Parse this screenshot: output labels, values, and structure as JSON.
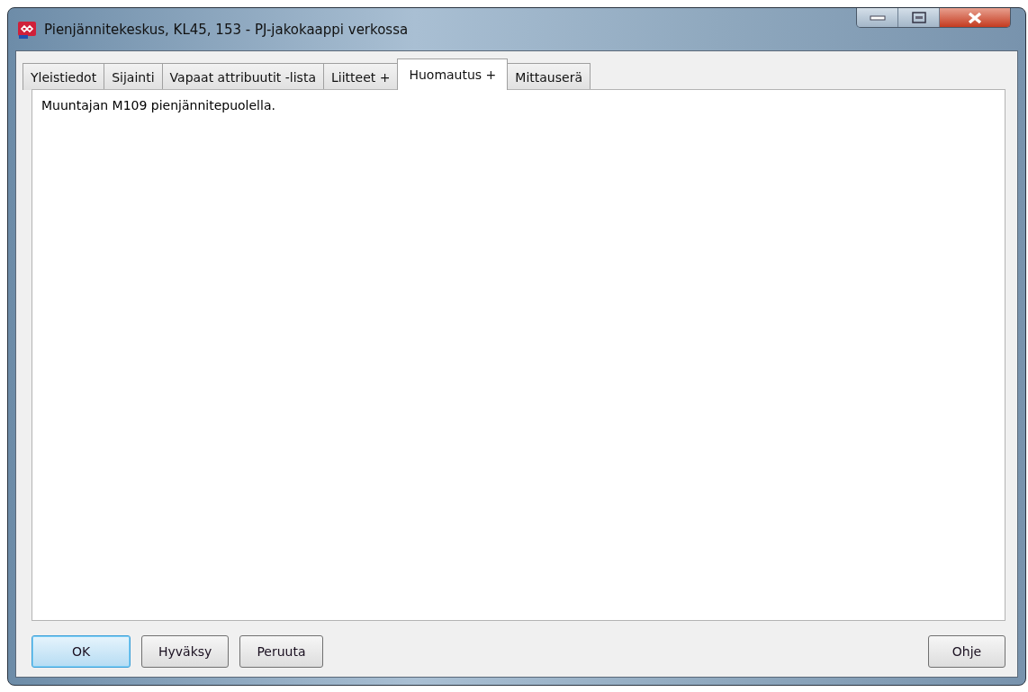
{
  "window": {
    "title": "Pienjännitekeskus, KL45, 153 - PJ-jakokaappi verkossa"
  },
  "tabs": [
    {
      "label": "Yleistiedot",
      "selected": false
    },
    {
      "label": "Sijainti",
      "selected": false
    },
    {
      "label": "Vapaat attribuutit -lista",
      "selected": false
    },
    {
      "label": "Liitteet +",
      "selected": false
    },
    {
      "label": "Huomautus +",
      "selected": true
    },
    {
      "label": "Mittauserä",
      "selected": false
    }
  ],
  "note": {
    "value": "Muuntajan M109 pienjännitepuolella."
  },
  "buttons": [
    {
      "label": "OK",
      "default": true,
      "kind": "action"
    },
    {
      "label": "Hyväksy",
      "default": false,
      "kind": "action"
    },
    {
      "label": "Peruuta",
      "default": false,
      "kind": "action"
    },
    {
      "label": "Ohje",
      "default": false,
      "kind": "help"
    }
  ]
}
